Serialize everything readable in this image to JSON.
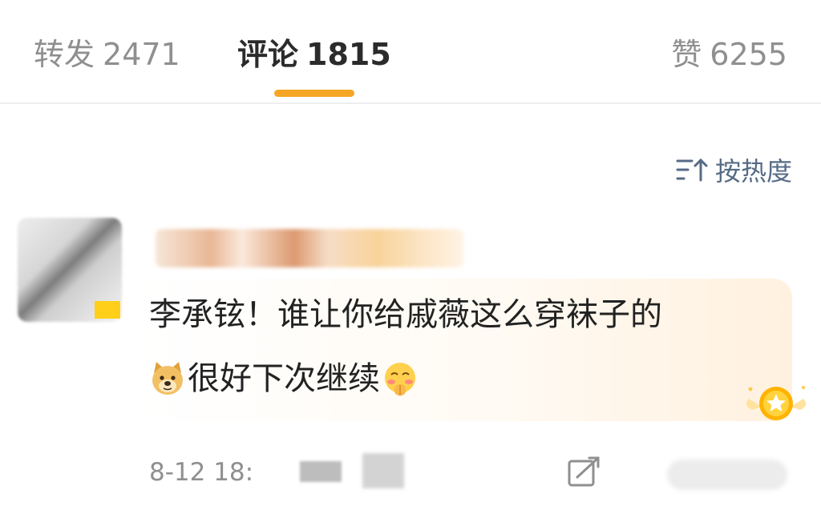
{
  "tabs": [
    {
      "label": "转发",
      "count": "2471",
      "active": false
    },
    {
      "label": "评论",
      "count": "1815",
      "active": true
    },
    {
      "label": "赞",
      "count": "6255",
      "active": false
    }
  ],
  "sort": {
    "label": "按热度",
    "icon": "sort-descending-icon"
  },
  "comment": {
    "text_line1": "李承铉！谁让你给戚薇这么穿袜子的",
    "text_line2": "很好下次继续",
    "emojis": [
      "doge-emoji",
      "blushing-face-emoji"
    ],
    "timestamp": "8-12 18:",
    "badge": "medal-icon"
  },
  "colors": {
    "accent": "#f5a623",
    "link": "#566b85",
    "text": "#222222",
    "muted": "#8f8f8f"
  }
}
